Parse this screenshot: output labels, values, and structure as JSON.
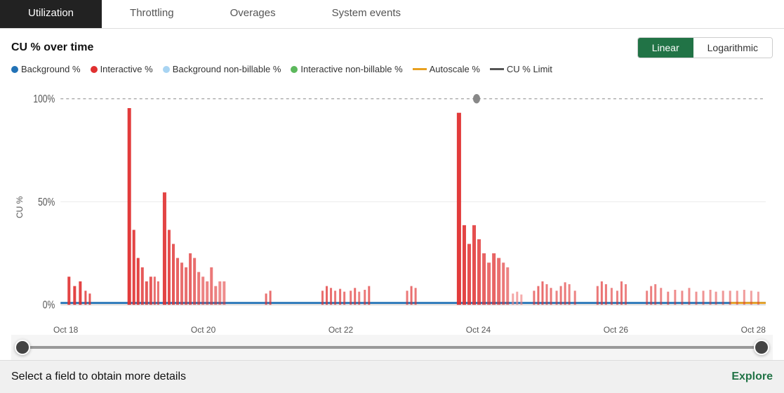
{
  "tabs": [
    {
      "label": "Utilization",
      "active": true
    },
    {
      "label": "Throttling",
      "active": false
    },
    {
      "label": "Overages",
      "active": false
    },
    {
      "label": "System events",
      "active": false
    }
  ],
  "chart": {
    "title": "CU % over time",
    "scale_buttons": [
      {
        "label": "Linear",
        "active": true
      },
      {
        "label": "Logarithmic",
        "active": false
      }
    ],
    "y_axis_label": "CU %",
    "y_labels": [
      "100%",
      "50%",
      "0%"
    ],
    "x_labels": [
      "Oct 18",
      "Oct 20",
      "Oct 22",
      "Oct 24",
      "Oct 26",
      "Oct 28"
    ],
    "legend": [
      {
        "type": "dot",
        "color": "#2272B6",
        "label": "Background %"
      },
      {
        "type": "dot",
        "color": "#E03030",
        "label": "Interactive %"
      },
      {
        "type": "dot",
        "color": "#A8D4F2",
        "label": "Background non-billable %"
      },
      {
        "type": "dot",
        "color": "#5CB85C",
        "label": "Interactive non-billable %"
      },
      {
        "type": "line",
        "color": "#E8A020",
        "label": "Autoscale %"
      },
      {
        "type": "line",
        "color": "#555555",
        "label": "CU % Limit"
      }
    ]
  },
  "bottom_bar": {
    "text": "Select a field to obtain more details",
    "explore_label": "Explore"
  },
  "colors": {
    "active_tab_bg": "#222222",
    "active_scale_bg": "#217346",
    "explore_color": "#217346"
  }
}
